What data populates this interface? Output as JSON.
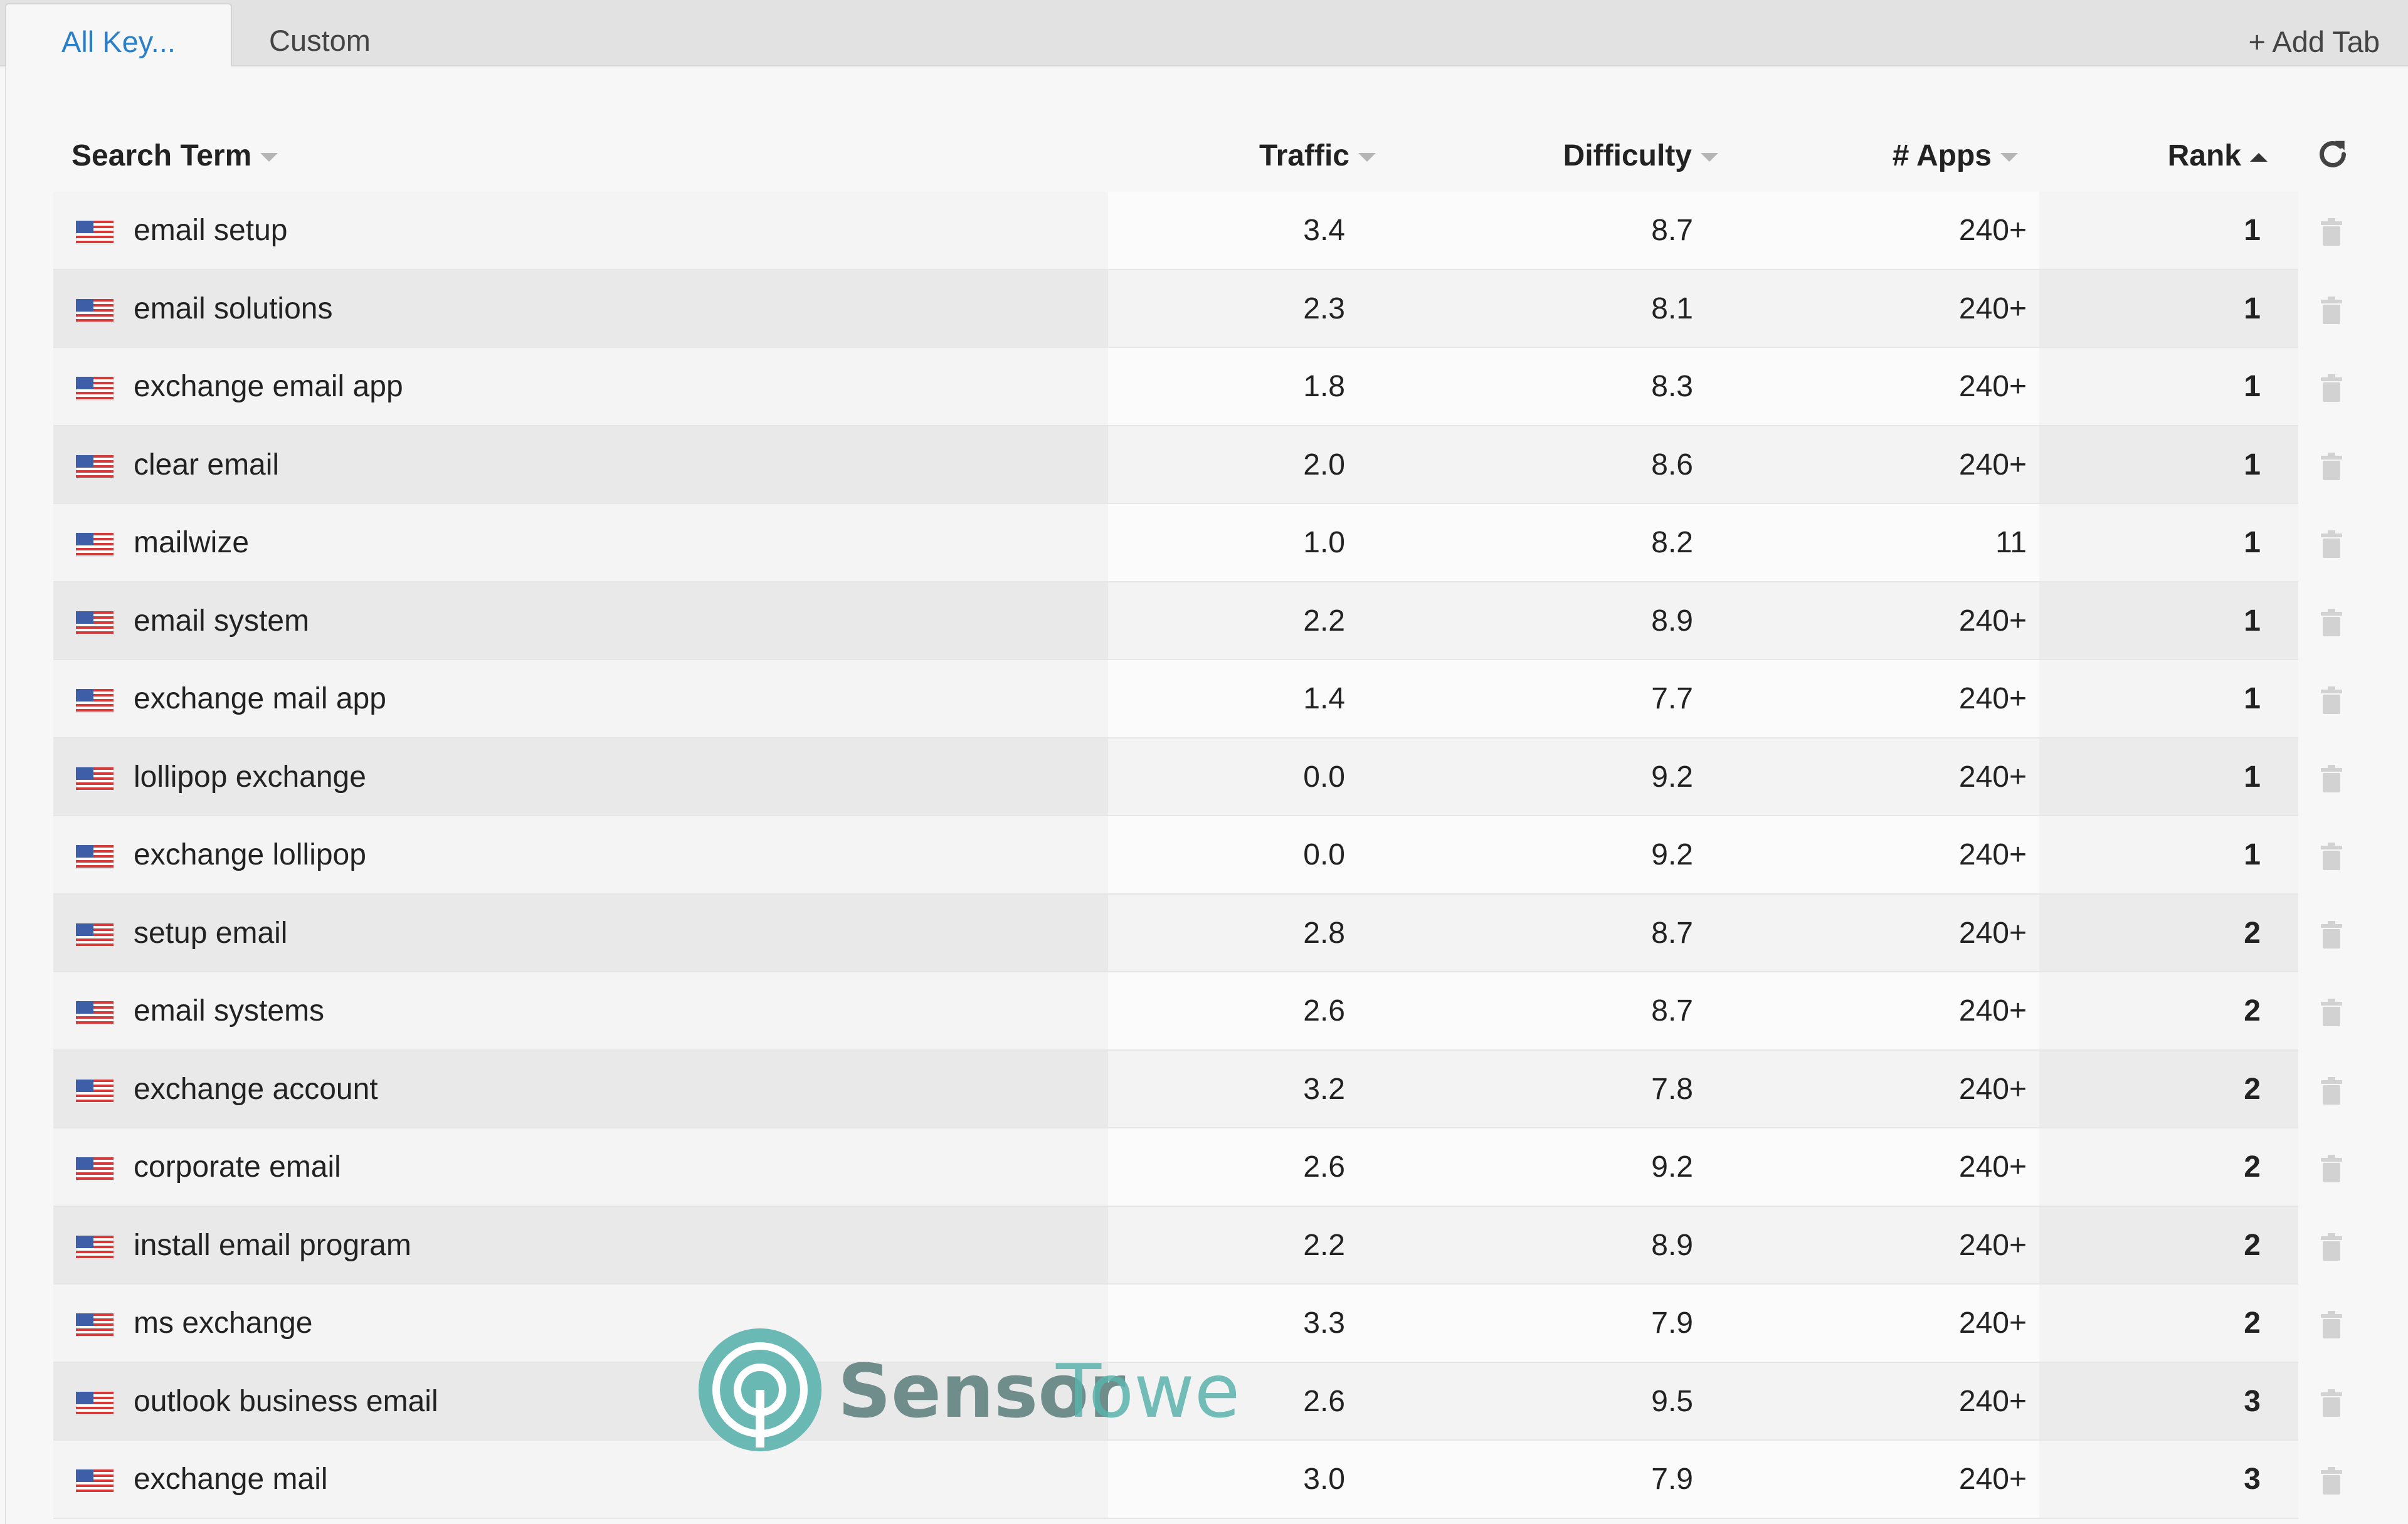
{
  "tabs": {
    "active_label": "All Key...",
    "custom_label": "Custom",
    "add_label": "+ Add Tab"
  },
  "columns": {
    "search_term": "Search Term",
    "traffic": "Traffic",
    "difficulty": "Difficulty",
    "apps": "# Apps",
    "rank": "Rank"
  },
  "colors": {
    "accent": "#2b7fc9",
    "watermark": "#5bb3ad"
  },
  "watermark": {
    "brand_part1": "Sensor",
    "brand_part2": "Tower"
  },
  "rows": [
    {
      "term": "email setup",
      "traffic": "3.4",
      "difficulty": "8.7",
      "apps": "240+",
      "rank": "1"
    },
    {
      "term": "email solutions",
      "traffic": "2.3",
      "difficulty": "8.1",
      "apps": "240+",
      "rank": "1"
    },
    {
      "term": "exchange email app",
      "traffic": "1.8",
      "difficulty": "8.3",
      "apps": "240+",
      "rank": "1"
    },
    {
      "term": "clear email",
      "traffic": "2.0",
      "difficulty": "8.6",
      "apps": "240+",
      "rank": "1"
    },
    {
      "term": "mailwize",
      "traffic": "1.0",
      "difficulty": "8.2",
      "apps": "11",
      "rank": "1"
    },
    {
      "term": "email system",
      "traffic": "2.2",
      "difficulty": "8.9",
      "apps": "240+",
      "rank": "1"
    },
    {
      "term": "exchange mail app",
      "traffic": "1.4",
      "difficulty": "7.7",
      "apps": "240+",
      "rank": "1"
    },
    {
      "term": "lollipop exchange",
      "traffic": "0.0",
      "difficulty": "9.2",
      "apps": "240+",
      "rank": "1"
    },
    {
      "term": "exchange lollipop",
      "traffic": "0.0",
      "difficulty": "9.2",
      "apps": "240+",
      "rank": "1"
    },
    {
      "term": "setup email",
      "traffic": "2.8",
      "difficulty": "8.7",
      "apps": "240+",
      "rank": "2"
    },
    {
      "term": "email systems",
      "traffic": "2.6",
      "difficulty": "8.7",
      "apps": "240+",
      "rank": "2"
    },
    {
      "term": "exchange account",
      "traffic": "3.2",
      "difficulty": "7.8",
      "apps": "240+",
      "rank": "2"
    },
    {
      "term": "corporate email",
      "traffic": "2.6",
      "difficulty": "9.2",
      "apps": "240+",
      "rank": "2"
    },
    {
      "term": "install email program",
      "traffic": "2.2",
      "difficulty": "8.9",
      "apps": "240+",
      "rank": "2"
    },
    {
      "term": "ms exchange",
      "traffic": "3.3",
      "difficulty": "7.9",
      "apps": "240+",
      "rank": "2"
    },
    {
      "term": "outlook business email",
      "traffic": "2.6",
      "difficulty": "9.5",
      "apps": "240+",
      "rank": "3"
    },
    {
      "term": "exchange mail",
      "traffic": "3.0",
      "difficulty": "7.9",
      "apps": "240+",
      "rank": "3"
    }
  ]
}
